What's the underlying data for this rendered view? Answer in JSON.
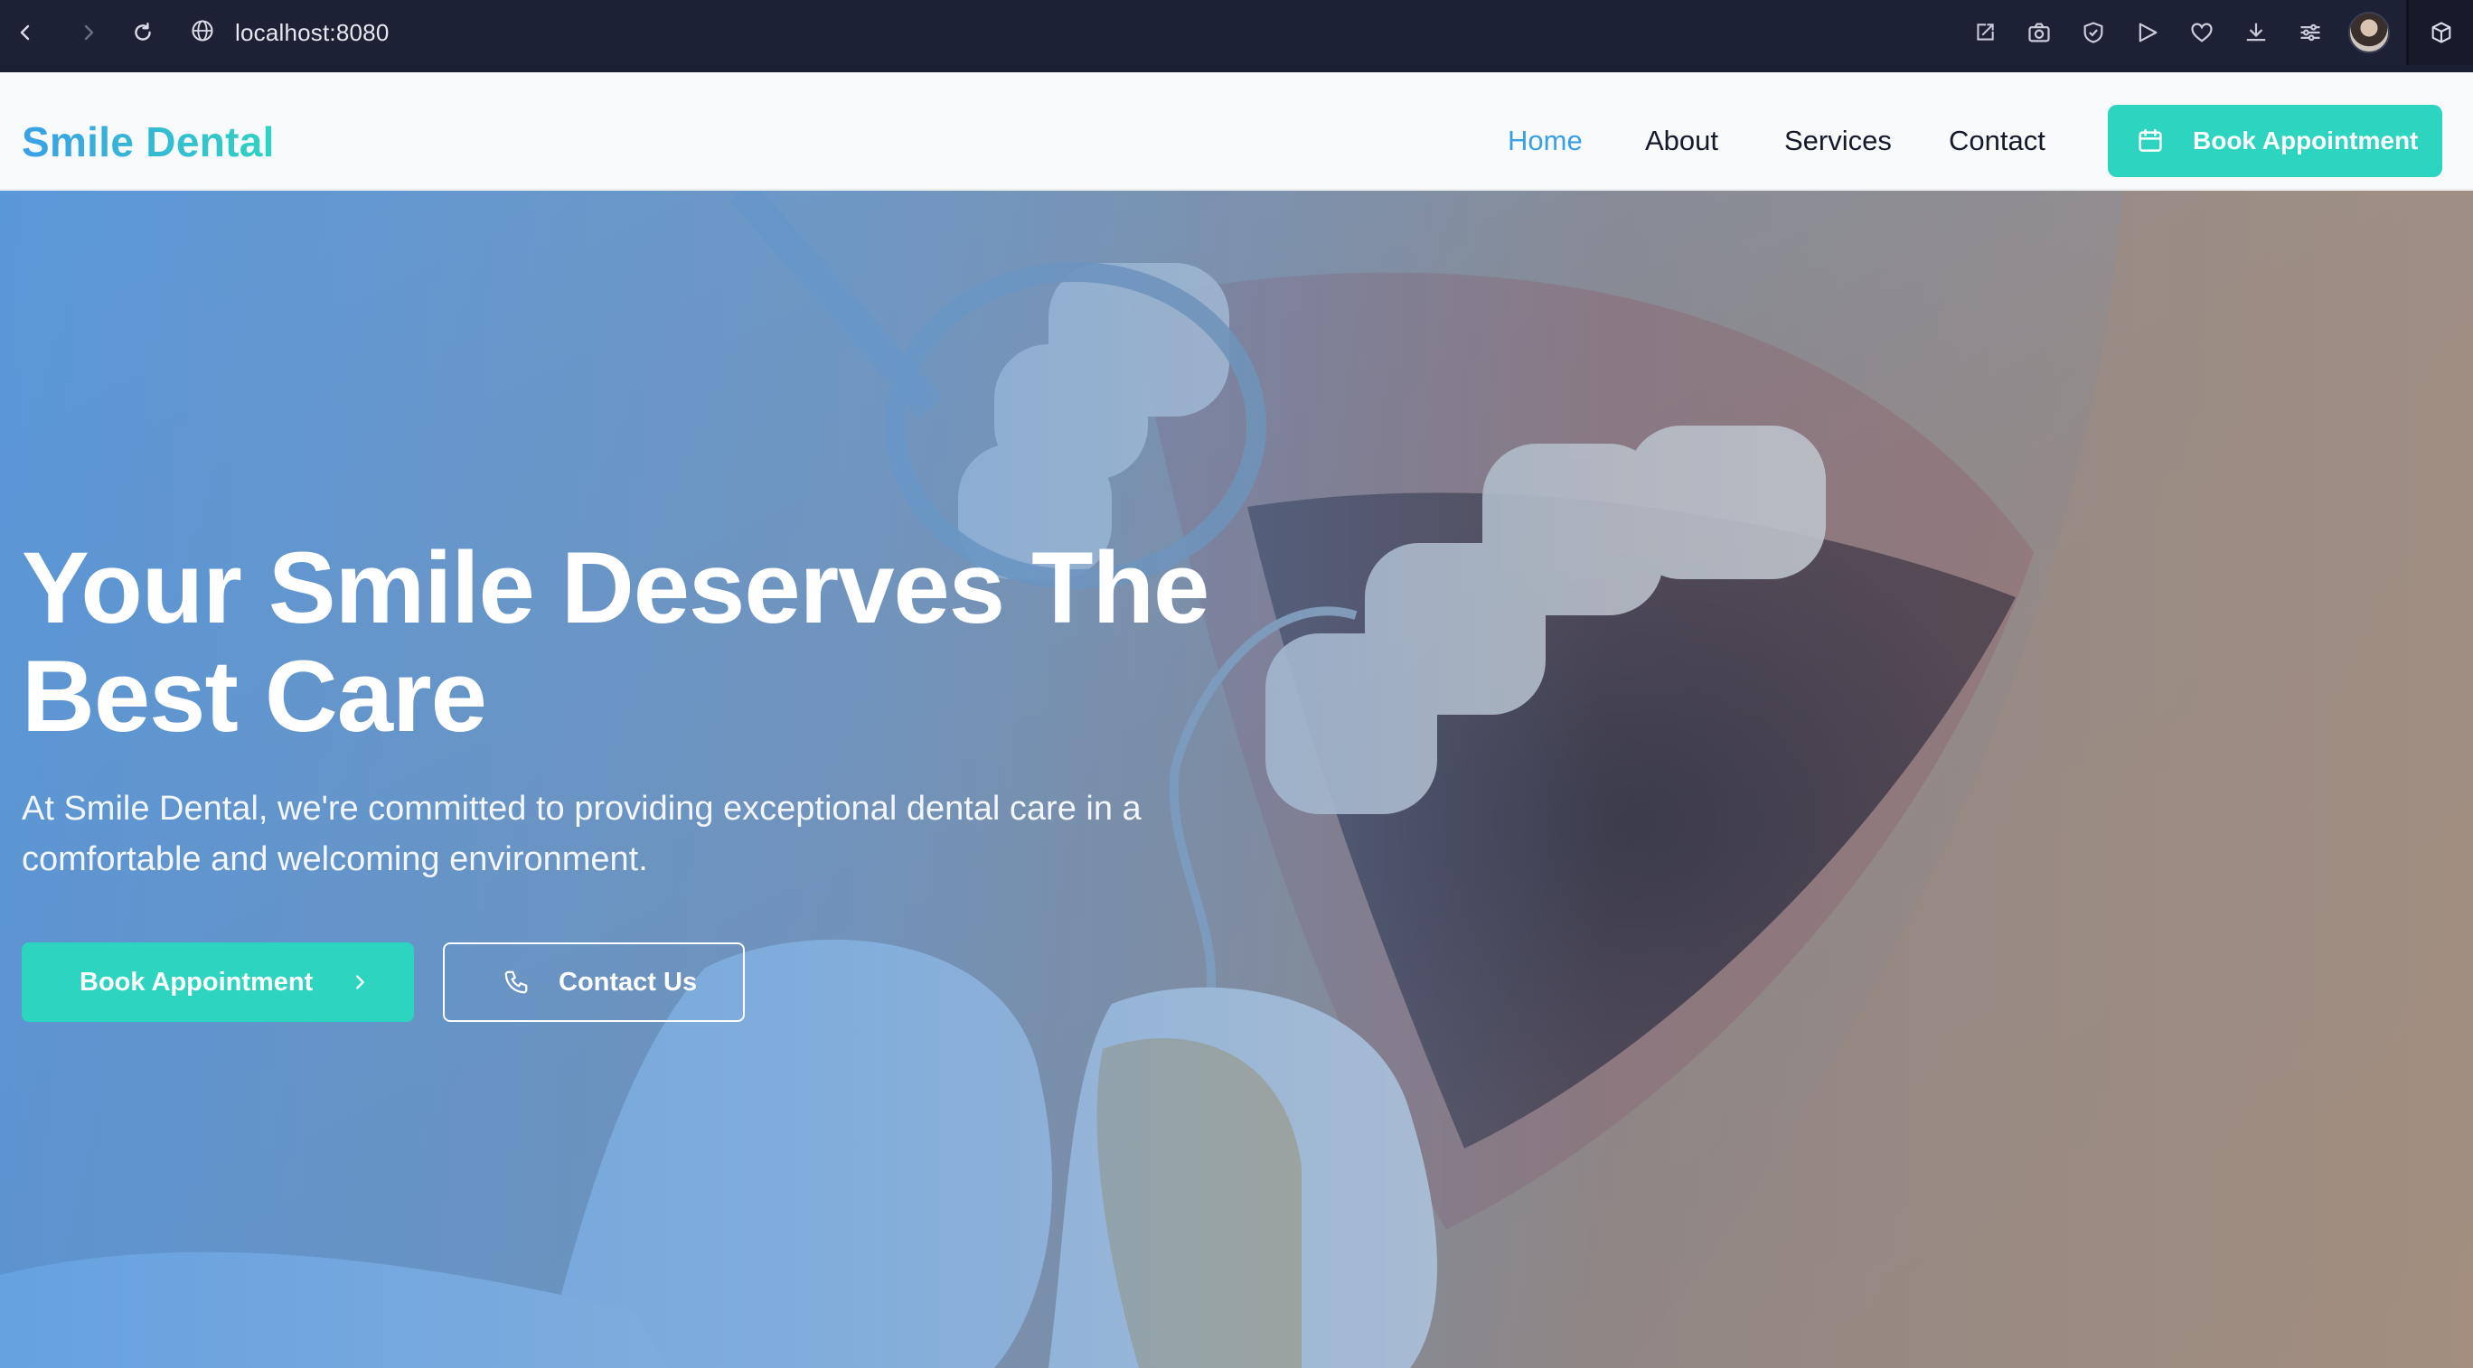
{
  "browser": {
    "url": "localhost:8080",
    "icons": [
      "back-icon",
      "forward-icon",
      "reload-icon",
      "globe-icon",
      "edit-share-icon",
      "camera-icon",
      "shield-icon",
      "send-icon",
      "heart-icon",
      "download-icon",
      "settings-sliders-icon",
      "avatar",
      "extensions-cube-icon"
    ]
  },
  "header": {
    "logo": "Smile Dental",
    "nav": [
      {
        "label": "Home",
        "active": true
      },
      {
        "label": "About",
        "active": false
      },
      {
        "label": "Services",
        "active": false
      },
      {
        "label": "Contact",
        "active": false
      }
    ],
    "cta": "Book Appointment"
  },
  "hero": {
    "title": "Your Smile Deserves The Best Care",
    "subtitle": "At Smile Dental, we're committed to providing exceptional dental care in a comfortable and welcoming environment.",
    "primary_button": "Book Appointment",
    "secondary_button": "Contact Us"
  },
  "colors": {
    "accent": "#2dd4bf",
    "nav_active": "#3b9fe3",
    "chrome": "#1c2136"
  }
}
